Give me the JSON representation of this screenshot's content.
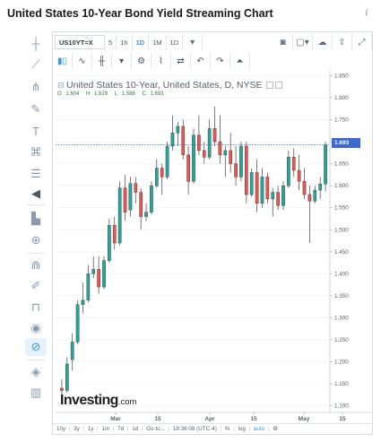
{
  "page": {
    "title": "United States 10-Year Bond Yield Streaming Chart",
    "info_icon": "info-icon"
  },
  "toolbar": {
    "symbol": "US10YT=X",
    "intervals": [
      "5",
      "1h",
      "1D",
      "1M",
      "1D"
    ],
    "active_interval": "1D",
    "dropdown_icon": "chevron-down-icon",
    "row1_right_icons": [
      "camera-icon",
      "square-icon",
      "cloud-icon",
      "cloud-upload-icon",
      "fullscreen-icon"
    ],
    "row2_icons": [
      "candles-icon",
      "line-chart-icon",
      "bars-icon",
      "chevron-down-icon",
      "gear-icon",
      "indicators-icon",
      "compare-icon",
      "undo-icon",
      "redo-icon",
      "alert-icon"
    ]
  },
  "left_tools": [
    "crosshair-icon",
    "trend-line-icon",
    "pitchfork-icon",
    "brush-icon",
    "text-icon",
    "pattern-icon",
    "fib-icon",
    "arrow-left-icon",
    "measure-icon",
    "zoom-icon",
    "magnet-icon",
    "pencil-lock-icon",
    "lock-icon",
    "eye-icon",
    "link-icon",
    "layers-icon",
    "trash-icon"
  ],
  "legend": {
    "title": "United States 10-Year, United States, D, NYSE",
    "open_label": "O",
    "open": "1.604",
    "high_label": "H",
    "high": "1.629",
    "low_label": "L",
    "low": "1.588",
    "close_label": "C",
    "close": "1.693"
  },
  "current_price": "1.693",
  "watermark": {
    "brand": "Investing",
    "suffix": ".com"
  },
  "bottom_bar": {
    "items": [
      "10y",
      "3y",
      "1y",
      "1m",
      "7d",
      "1d",
      "Go to...",
      "18:36:08 (UTC-4)",
      "%",
      "log",
      "auto"
    ],
    "active": "auto",
    "gear_icon": "gear-icon"
  },
  "colors": {
    "up": "#26a69a",
    "down": "#ef5350",
    "accent": "#3b97e3",
    "price_line": "#3b68d3"
  },
  "chart_data": {
    "type": "candlestick",
    "title": "United States 10-Year, United States, D, NYSE",
    "x_ticks": [
      "Mar",
      "15",
      "Apr",
      "15",
      "May",
      "15"
    ],
    "y_ticks": [
      "1.850",
      "1.800",
      "1.750",
      "1.700",
      "1.650",
      "1.600",
      "1.550",
      "1.500",
      "1.450",
      "1.400",
      "1.350",
      "1.300",
      "1.250",
      "1.200",
      "1.150",
      "1.100"
    ],
    "ylim": [
      1.085,
      1.855
    ],
    "current_price": 1.693,
    "candles": [
      {
        "o": 1.14,
        "h": 1.16,
        "l": 1.12,
        "c": 1.135
      },
      {
        "o": 1.135,
        "h": 1.21,
        "l": 1.13,
        "c": 1.195
      },
      {
        "o": 1.205,
        "h": 1.265,
        "l": 1.18,
        "c": 1.245
      },
      {
        "o": 1.245,
        "h": 1.34,
        "l": 1.24,
        "c": 1.33
      },
      {
        "o": 1.33,
        "h": 1.38,
        "l": 1.31,
        "c": 1.34
      },
      {
        "o": 1.34,
        "h": 1.42,
        "l": 1.335,
        "c": 1.4
      },
      {
        "o": 1.4,
        "h": 1.44,
        "l": 1.39,
        "c": 1.41
      },
      {
        "o": 1.41,
        "h": 1.44,
        "l": 1.355,
        "c": 1.37
      },
      {
        "o": 1.37,
        "h": 1.44,
        "l": 1.365,
        "c": 1.43
      },
      {
        "o": 1.43,
        "h": 1.525,
        "l": 1.425,
        "c": 1.51
      },
      {
        "o": 1.51,
        "h": 1.53,
        "l": 1.455,
        "c": 1.47
      },
      {
        "o": 1.47,
        "h": 1.61,
        "l": 1.465,
        "c": 1.595
      },
      {
        "o": 1.595,
        "h": 1.625,
        "l": 1.52,
        "c": 1.54
      },
      {
        "o": 1.545,
        "h": 1.62,
        "l": 1.53,
        "c": 1.605
      },
      {
        "o": 1.605,
        "h": 1.62,
        "l": 1.56,
        "c": 1.585
      },
      {
        "o": 1.585,
        "h": 1.595,
        "l": 1.5,
        "c": 1.53
      },
      {
        "o": 1.53,
        "h": 1.56,
        "l": 1.52,
        "c": 1.54
      },
      {
        "o": 1.54,
        "h": 1.61,
        "l": 1.535,
        "c": 1.6
      },
      {
        "o": 1.6,
        "h": 1.66,
        "l": 1.595,
        "c": 1.64
      },
      {
        "o": 1.64,
        "h": 1.65,
        "l": 1.58,
        "c": 1.62
      },
      {
        "o": 1.62,
        "h": 1.7,
        "l": 1.615,
        "c": 1.69
      },
      {
        "o": 1.69,
        "h": 1.76,
        "l": 1.68,
        "c": 1.72
      },
      {
        "o": 1.72,
        "h": 1.745,
        "l": 1.69,
        "c": 1.735
      },
      {
        "o": 1.735,
        "h": 1.75,
        "l": 1.66,
        "c": 1.67
      },
      {
        "o": 1.67,
        "h": 1.69,
        "l": 1.58,
        "c": 1.61
      },
      {
        "o": 1.61,
        "h": 1.73,
        "l": 1.605,
        "c": 1.715
      },
      {
        "o": 1.715,
        "h": 1.76,
        "l": 1.67,
        "c": 1.68
      },
      {
        "o": 1.68,
        "h": 1.7,
        "l": 1.65,
        "c": 1.665
      },
      {
        "o": 1.665,
        "h": 1.75,
        "l": 1.66,
        "c": 1.73
      },
      {
        "o": 1.73,
        "h": 1.78,
        "l": 1.69,
        "c": 1.7
      },
      {
        "o": 1.7,
        "h": 1.76,
        "l": 1.65,
        "c": 1.67
      },
      {
        "o": 1.67,
        "h": 1.69,
        "l": 1.62,
        "c": 1.68
      },
      {
        "o": 1.68,
        "h": 1.72,
        "l": 1.63,
        "c": 1.65
      },
      {
        "o": 1.65,
        "h": 1.69,
        "l": 1.6,
        "c": 1.62
      },
      {
        "o": 1.62,
        "h": 1.7,
        "l": 1.61,
        "c": 1.69
      },
      {
        "o": 1.69,
        "h": 1.7,
        "l": 1.56,
        "c": 1.58
      },
      {
        "o": 1.58,
        "h": 1.64,
        "l": 1.575,
        "c": 1.63
      },
      {
        "o": 1.63,
        "h": 1.66,
        "l": 1.54,
        "c": 1.56
      },
      {
        "o": 1.56,
        "h": 1.64,
        "l": 1.55,
        "c": 1.62
      },
      {
        "o": 1.62,
        "h": 1.63,
        "l": 1.56,
        "c": 1.57
      },
      {
        "o": 1.57,
        "h": 1.595,
        "l": 1.53,
        "c": 1.585
      },
      {
        "o": 1.585,
        "h": 1.6,
        "l": 1.545,
        "c": 1.555
      },
      {
        "o": 1.555,
        "h": 1.61,
        "l": 1.545,
        "c": 1.6
      },
      {
        "o": 1.6,
        "h": 1.68,
        "l": 1.595,
        "c": 1.665
      },
      {
        "o": 1.665,
        "h": 1.685,
        "l": 1.62,
        "c": 1.635
      },
      {
        "o": 1.635,
        "h": 1.67,
        "l": 1.59,
        "c": 1.61
      },
      {
        "o": 1.61,
        "h": 1.64,
        "l": 1.57,
        "c": 1.58
      },
      {
        "o": 1.58,
        "h": 1.6,
        "l": 1.47,
        "c": 1.565
      },
      {
        "o": 1.565,
        "h": 1.6,
        "l": 1.56,
        "c": 1.59
      },
      {
        "o": 1.59,
        "h": 1.62,
        "l": 1.57,
        "c": 1.604
      },
      {
        "o": 1.604,
        "h": 1.7,
        "l": 1.588,
        "c": 1.693
      }
    ],
    "grid": true
  }
}
